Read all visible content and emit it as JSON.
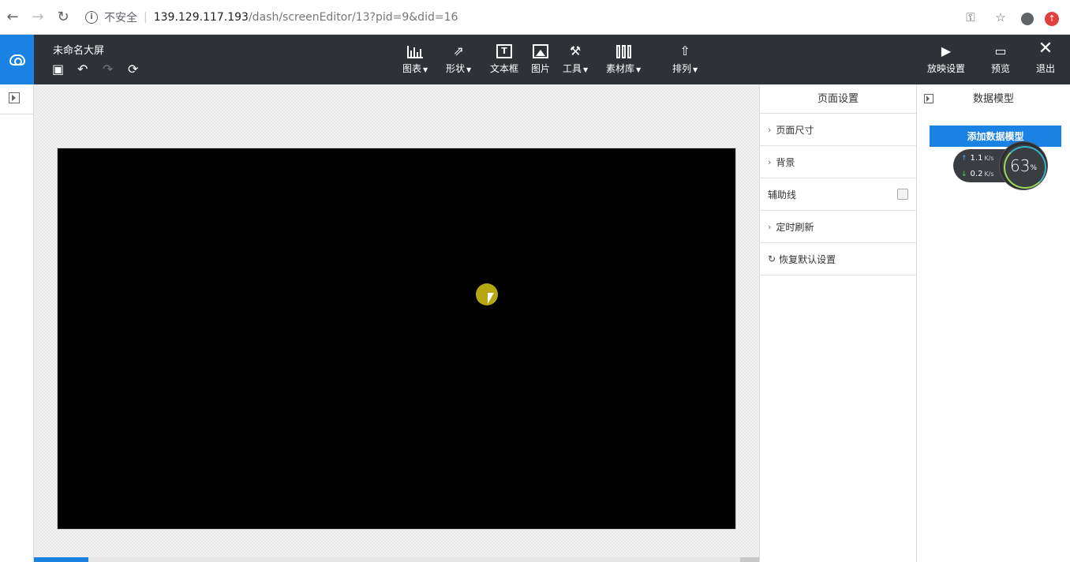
{
  "browser": {
    "security_label": "不安全",
    "url_host": "139.129.117.193",
    "url_path": "/dash/screenEditor/13?pid=9&did=16"
  },
  "toolbar": {
    "doc_title": "未命名大屏",
    "tools": [
      {
        "label": "图表",
        "icon": "bar-chart-icon",
        "has_menu": true
      },
      {
        "label": "形状",
        "icon": "share-shape-icon",
        "has_menu": true
      },
      {
        "label": "文本框",
        "icon": "text-box-icon",
        "has_menu": false
      },
      {
        "label": "图片",
        "icon": "image-icon",
        "has_menu": false
      },
      {
        "label": "工具",
        "icon": "hammer-icon",
        "has_menu": true
      },
      {
        "label": "素材库",
        "icon": "library-icon",
        "has_menu": true
      },
      {
        "label": "排列",
        "icon": "arrange-icon",
        "has_menu": true
      }
    ],
    "right_actions": [
      {
        "label": "放映设置",
        "icon": "play-icon"
      },
      {
        "label": "预览",
        "icon": "preview-icon"
      },
      {
        "label": "退出",
        "icon": "close-icon"
      }
    ]
  },
  "settings_panel": {
    "title": "页面设置",
    "rows": [
      {
        "label": "页面尺寸",
        "type": "expand"
      },
      {
        "label": "背景",
        "type": "expand"
      },
      {
        "label": "辅助线",
        "type": "checkbox",
        "checked": false
      },
      {
        "label": "定时刷新",
        "type": "expand"
      },
      {
        "label": "恢复默认设置",
        "type": "reset"
      }
    ]
  },
  "model_panel": {
    "title": "数据模型",
    "add_button": "添加数据模型"
  },
  "net_widget": {
    "upload": "1.1",
    "download": "0.2",
    "unit": "K/s",
    "percent": "63",
    "percent_sign": "%"
  },
  "colors": {
    "accent": "#1a82e2",
    "toolbar_bg": "#2e3136",
    "canvas_bg": "#000000"
  }
}
